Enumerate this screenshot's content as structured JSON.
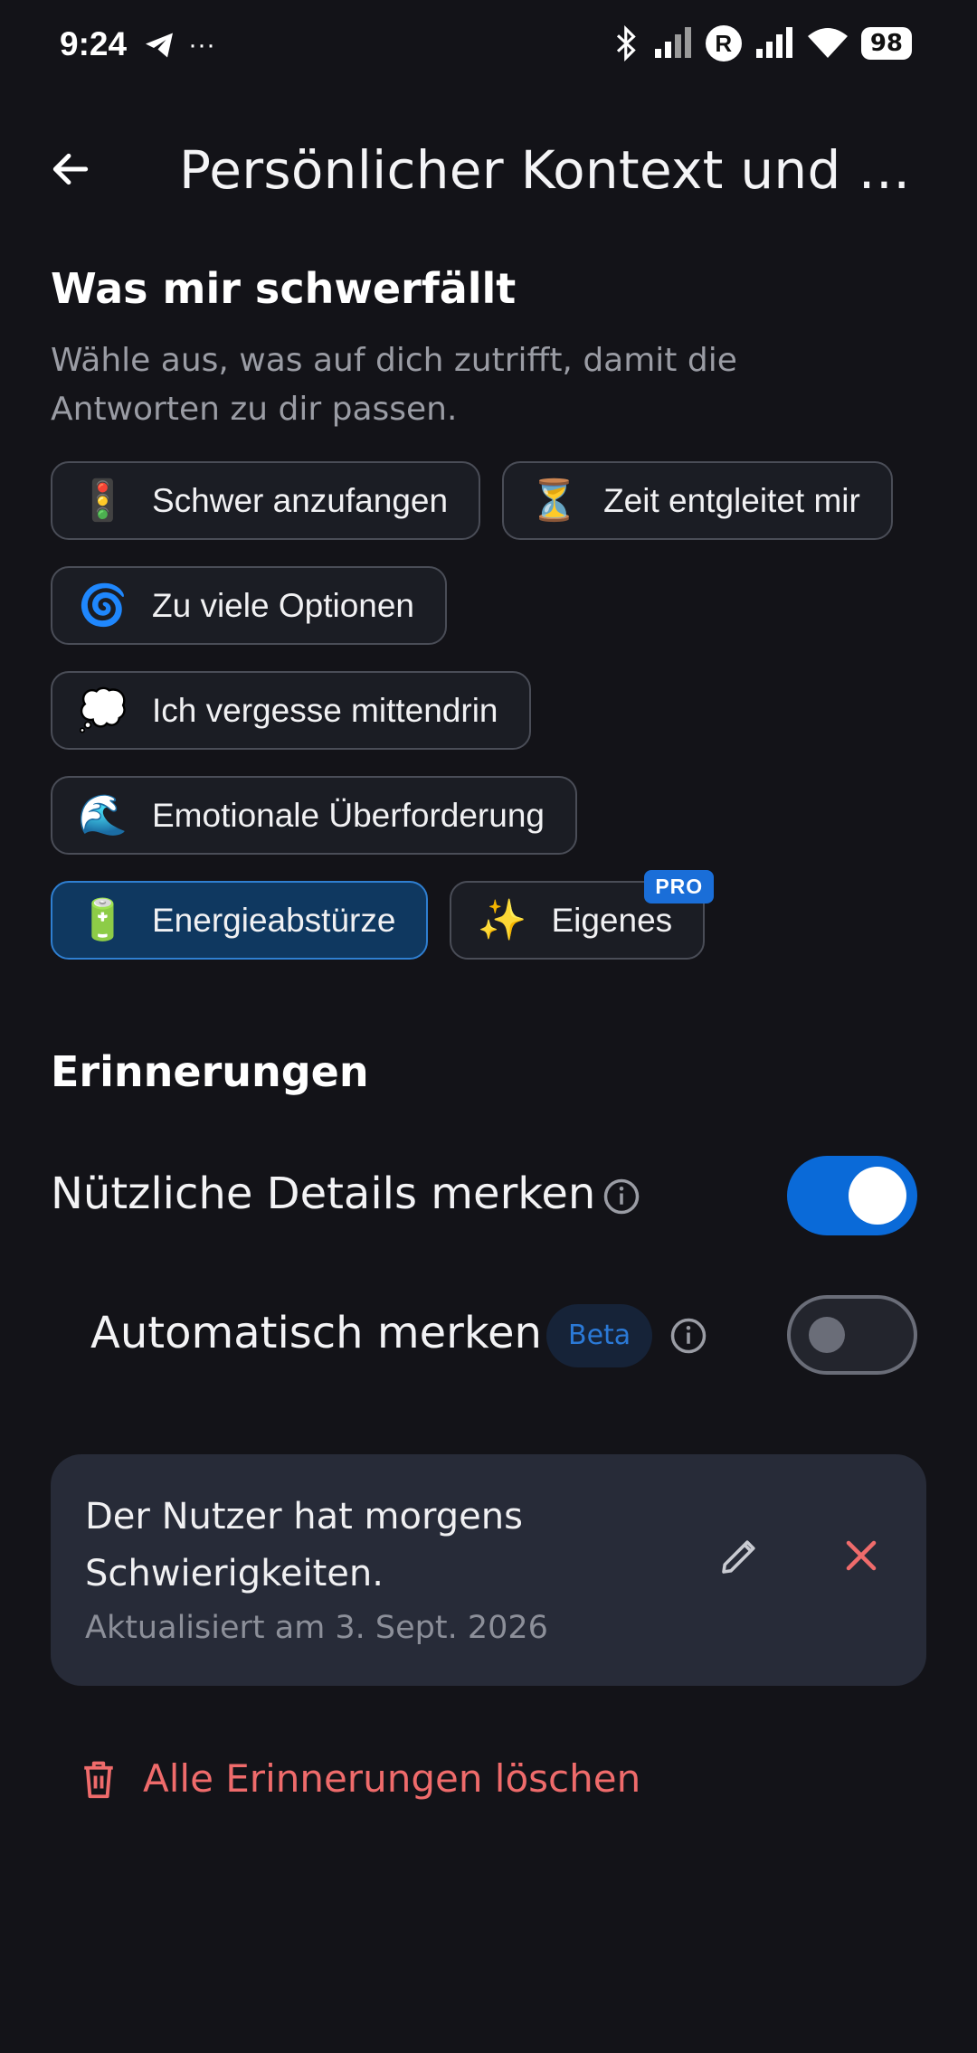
{
  "status_bar": {
    "time": "9:24",
    "battery": "98",
    "r_badge": "R",
    "more": "···"
  },
  "app_bar": {
    "title": "Persönlicher Kontext und Erinnerungen"
  },
  "struggles": {
    "heading": "Was mir schwerfällt",
    "description": "Wähle aus, was auf dich zutrifft, damit die Antworten zu dir passen.",
    "chips": [
      {
        "icon": "🚦",
        "label": "Schwer anzufangen",
        "selected": false
      },
      {
        "icon": "⏳",
        "label": "Zeit entgleitet mir",
        "selected": false
      },
      {
        "icon": "🌀",
        "label": "Zu viele Optionen",
        "selected": false
      },
      {
        "icon": "💭",
        "label": "Ich vergesse mittendrin",
        "selected": false
      },
      {
        "icon": "🌊",
        "label": "Emotionale Überforderung",
        "selected": false
      },
      {
        "icon": "🔋",
        "label": "Energieabstürze",
        "selected": true
      },
      {
        "icon": "✨",
        "label": "Eigenes",
        "selected": false,
        "badge": "PRO"
      }
    ]
  },
  "memories": {
    "heading": "Erinnerungen",
    "save_details_label": "Nützliche Details merken",
    "save_details_on": true,
    "auto_save_label": "Automatisch merken",
    "auto_save_badge": "Beta",
    "auto_save_on": false,
    "items": [
      {
        "text": "Der Nutzer hat morgens Schwierigkeiten.",
        "updated": "Aktualisiert am 3. Sept. 2026"
      }
    ],
    "delete_all_label": "Alle Erinnerungen löschen"
  },
  "colors": {
    "background": "#131318",
    "accent": "#0a6ad8",
    "danger": "#ef6b6b",
    "card": "#272b38"
  }
}
